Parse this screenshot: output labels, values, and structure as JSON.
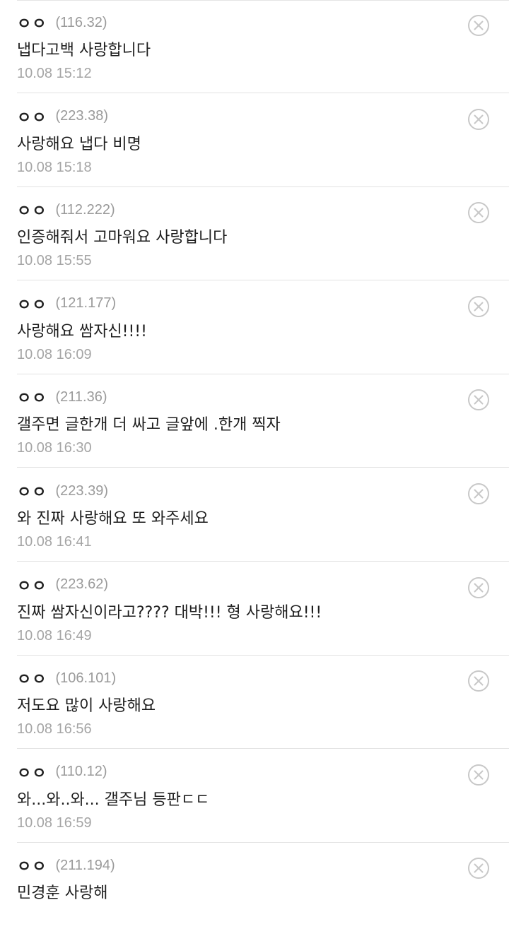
{
  "comments": [
    {
      "nick": "ㅇㅇ",
      "ip": "(116.32)",
      "text": "냅다고백 사랑합니다",
      "time": "10.08 15:12"
    },
    {
      "nick": "ㅇㅇ",
      "ip": "(223.38)",
      "text": "사랑해요 냅다 비명",
      "time": "10.08 15:18"
    },
    {
      "nick": "ㅇㅇ",
      "ip": "(112.222)",
      "text": "인증해줘서 고마워요 사랑합니다",
      "time": "10.08 15:55"
    },
    {
      "nick": "ㅇㅇ",
      "ip": "(121.177)",
      "text": "사랑해요 쌈자신!!!!",
      "time": "10.08 16:09"
    },
    {
      "nick": "ㅇㅇ",
      "ip": "(211.36)",
      "text": "갤주면 글한개 더 싸고 글앞에 .한개 찍자",
      "time": "10.08 16:30"
    },
    {
      "nick": "ㅇㅇ",
      "ip": "(223.39)",
      "text": "와 진짜 사랑해요 또 와주세요",
      "time": "10.08 16:41"
    },
    {
      "nick": "ㅇㅇ",
      "ip": "(223.62)",
      "text": "진짜 쌈자신이라고???? 대박!!! 형 사랑해요!!!",
      "time": "10.08 16:49"
    },
    {
      "nick": "ㅇㅇ",
      "ip": "(106.101)",
      "text": "저도요 많이 사랑해요",
      "time": "10.08 16:56"
    },
    {
      "nick": "ㅇㅇ",
      "ip": "(110.12)",
      "text": "와...와..와... 갤주님 등판ㄷㄷ",
      "time": "10.08 16:59"
    },
    {
      "nick": "ㅇㅇ",
      "ip": "(211.194)",
      "text": "민경훈 사랑해",
      "time": ""
    }
  ],
  "icons": {
    "delete": "close-circle-icon"
  },
  "colors": {
    "icon": "#c8c8c8",
    "meta": "#9a9a9a",
    "separator": "#e2e2e2"
  }
}
